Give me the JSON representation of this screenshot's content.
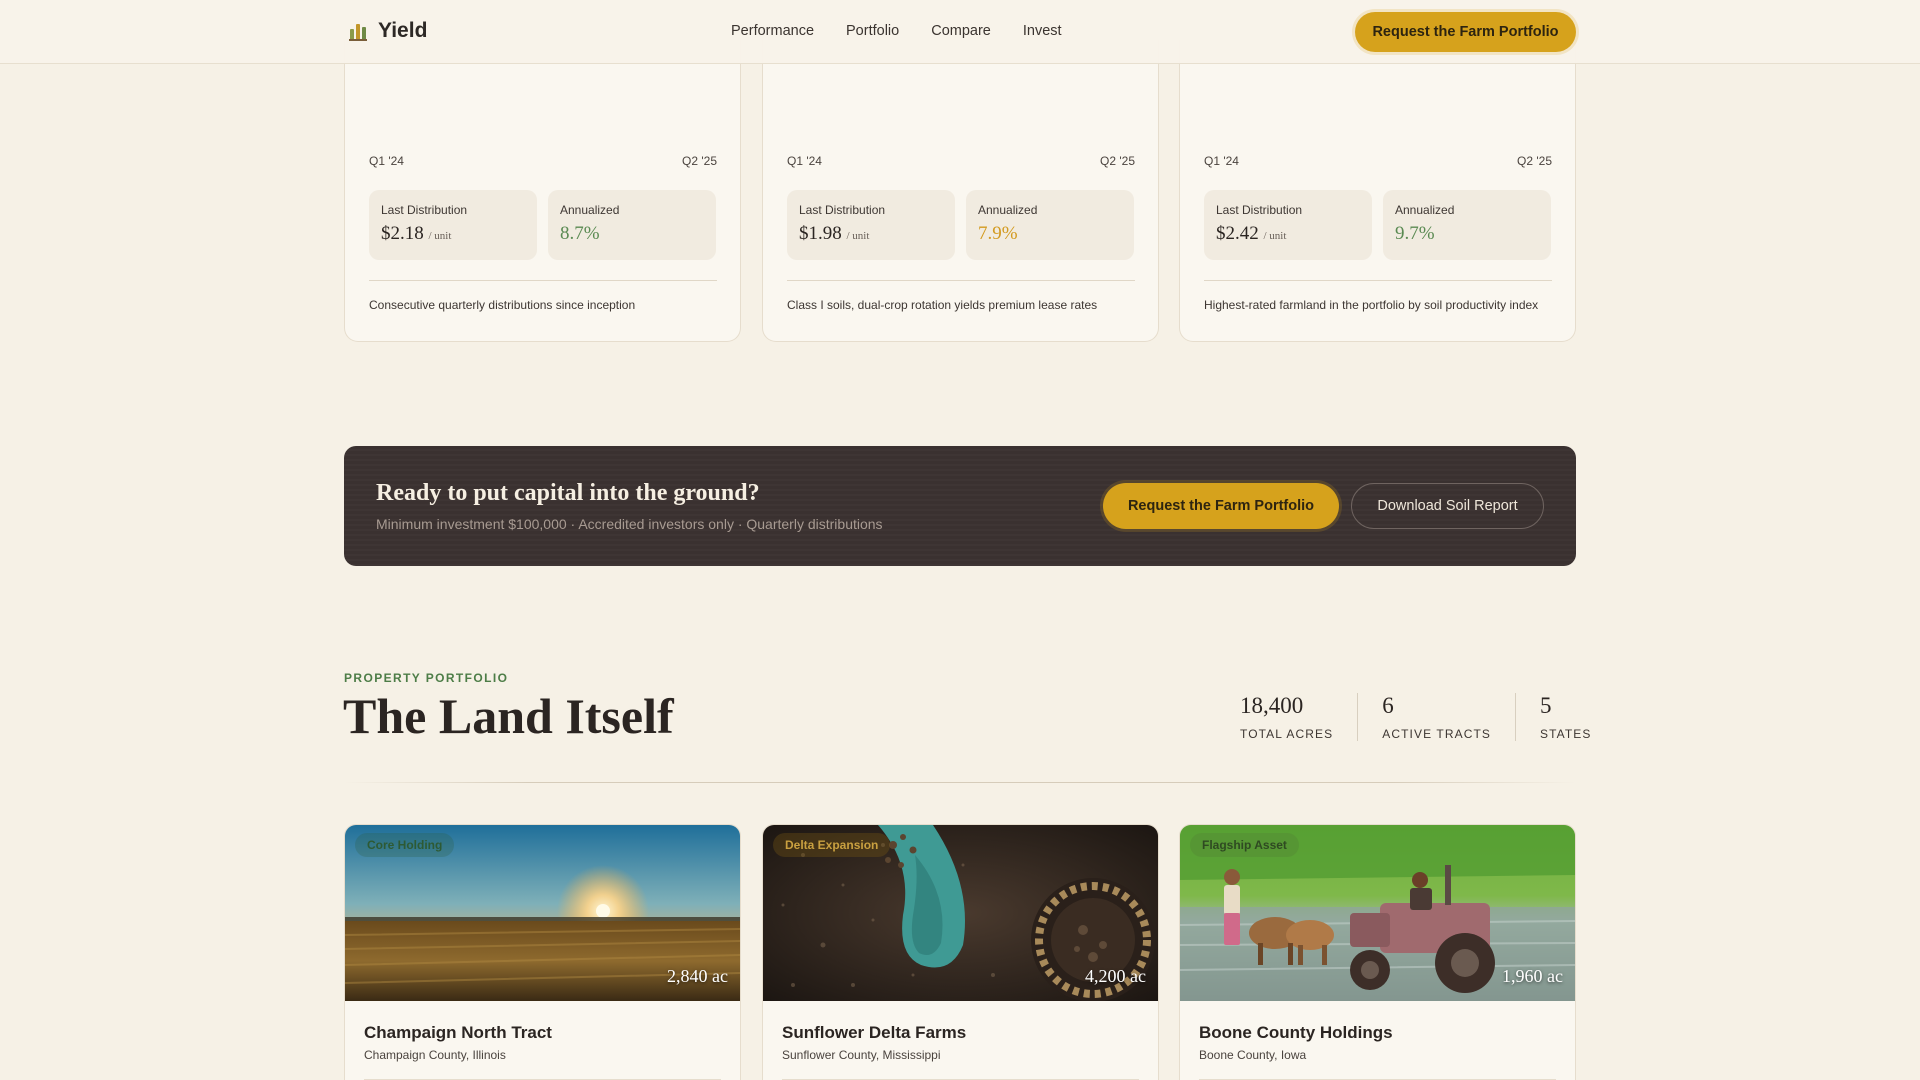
{
  "nav": {
    "brand": "Yield",
    "links": [
      "Performance",
      "Portfolio",
      "Compare",
      "Invest"
    ],
    "cta": "Request the Farm Portfolio"
  },
  "performance_cards": [
    {
      "q_start": "Q1 '24",
      "q_end": "Q2 '25",
      "last_label": "Last Distribution",
      "last_value": "$2.18",
      "unit": "/ unit",
      "annual_label": "Annualized",
      "annual_value": "8.7%",
      "annual_color": "#5a8a52",
      "note": "Consecutive quarterly distributions since inception"
    },
    {
      "q_start": "Q1 '24",
      "q_end": "Q2 '25",
      "last_label": "Last Distribution",
      "last_value": "$1.98",
      "unit": "/ unit",
      "annual_label": "Annualized",
      "annual_value": "7.9%",
      "annual_color": "#d39a1f",
      "note": "Class I soils, dual-crop rotation yields premium lease rates"
    },
    {
      "q_start": "Q1 '24",
      "q_end": "Q2 '25",
      "last_label": "Last Distribution",
      "last_value": "$2.42",
      "unit": "/ unit",
      "annual_label": "Annualized",
      "annual_value": "9.7%",
      "annual_color": "#5a8a52",
      "note": "Highest-rated farmland in the portfolio by soil productivity index"
    }
  ],
  "cta": {
    "title": "Ready to put capital into the ground?",
    "subtitle": "Minimum investment $100,000 · Accredited investors only · Quarterly distributions",
    "primary": "Request the Farm Portfolio",
    "secondary": "Download Soil Report"
  },
  "portfolio": {
    "eyebrow": "PROPERTY PORTFOLIO",
    "title": "The Land Itself",
    "stats": [
      {
        "value": "18,400",
        "label": "TOTAL ACRES"
      },
      {
        "value": "6",
        "label": "ACTIVE TRACTS"
      },
      {
        "value": "5",
        "label": "STATES"
      }
    ],
    "properties": [
      {
        "tag": "Core Holding",
        "acres": "2,840 ac",
        "name": "Champaign North Tract",
        "location": "Champaign County, Illinois"
      },
      {
        "tag": "Delta Expansion",
        "acres": "4,200 ac",
        "name": "Sunflower Delta Farms",
        "location": "Sunflower County, Mississippi"
      },
      {
        "tag": "Flagship Asset",
        "acres": "1,960 ac",
        "name": "Boone County Holdings",
        "location": "Boone County, Iowa"
      }
    ]
  },
  "colors": {
    "accent_gold": "#d6a21c",
    "accent_green": "#4d7d47",
    "banner_dark": "#3a3130",
    "page_bg": "#f6f1e6"
  }
}
